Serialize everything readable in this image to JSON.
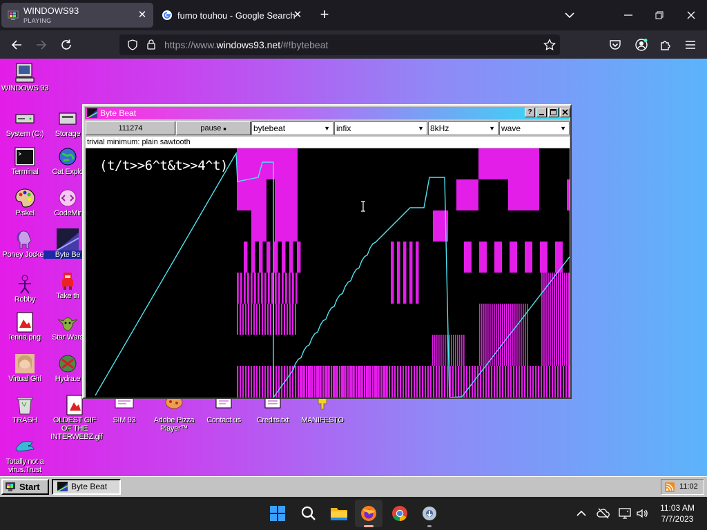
{
  "browser": {
    "tabs": [
      {
        "title": "WINDOWS93",
        "subtitle": "PLAYING",
        "active": true
      },
      {
        "title": "fumo touhou - Google Search",
        "active": false
      }
    ],
    "url_prefix": "https://www.",
    "url_domain": "windows93.net",
    "url_suffix": "/#!bytebeat"
  },
  "desktop": {
    "icons": {
      "windows93": "WINDOWS 93",
      "system": "System (C:)",
      "storage": "Storage",
      "terminal": "Terminal",
      "cat_explorer": "Cat Explo",
      "piskel": "Piskel",
      "codemirror": "CodeMir",
      "poney_jockey": "Poney Jockey",
      "bytebeat": "Byte Be",
      "robby": "Robby",
      "take": "Take th",
      "lenna": "lenna.png",
      "star_wars": "Star Wars",
      "virtual_girl": "Virtual Girl",
      "hydra": "Hydra.e",
      "trash": "TRASH",
      "oldest_gif": "OLDEST GIF OF THE INTERWEBZ.gif",
      "sim93": "SIM 93",
      "adobe_pizza": "Adobe Pizza Player™",
      "contact": "Contact us",
      "credits": "Credits.txt",
      "manifesto": "MANIFESTO",
      "virus": "Totally not a virus.Trust"
    }
  },
  "bytebeat": {
    "title": "Byte Beat",
    "title_buttons": [
      "?",
      "_",
      "□",
      "X"
    ],
    "counter": "111274",
    "pause_label": "pause",
    "mode": "bytebeat",
    "notation": "infix",
    "rate": "8kHz",
    "view": "wave",
    "description": "trivial minimum: plain sawtooth",
    "formula": "(t/t>>6^t&t>>4^t)"
  },
  "w93_taskbar": {
    "start": "Start",
    "task": "Byte Beat",
    "tray_time": "11:02"
  },
  "windows_taskbar": {
    "time": "11:03 AM",
    "date": "7/7/2023"
  },
  "colors": {
    "desktop_left": "#e31ce8",
    "desktop_right": "#5cb4fb",
    "viz_magenta": "#e21ee8",
    "viz_cyan": "#4fe3f0"
  }
}
